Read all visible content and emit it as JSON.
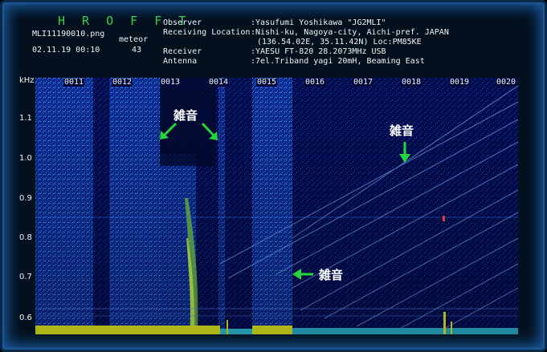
{
  "header": {
    "title": "H R O F F T",
    "filename": "MLI11190010.png",
    "mode": "meteor",
    "datetime": "02.11.19 00:10",
    "count": "43",
    "observer_label": "Observer",
    "observer_value": ":Yasufumi Yoshikawa \"JG2MLI\"",
    "location_label": "Receiving Location",
    "location_value": ":Nishi-ku, Nagoya-city, Aichi-pref. JAPAN",
    "location_value2": "(136.54.02E, 35.11.42N) Loc:PM85KE",
    "receiver_label": "Receiver",
    "receiver_value": ":YAESU FT-820 28.2073MHz USB",
    "antenna_label": "Antenna",
    "antenna_value": ":7el.Triband yagi 20mH, Beaming East"
  },
  "spectrogram": {
    "y_unit": "kHz",
    "y_ticks": [
      "1.1",
      "1.0",
      "0.9",
      "0.8",
      "0.7",
      "0.6"
    ],
    "x_ticks": [
      "0011",
      "0012",
      "0013",
      "0014",
      "0015",
      "0016",
      "0017",
      "0018",
      "0019",
      "0020"
    ],
    "colors": {
      "background": "#020a3a",
      "noise": "#1e6ad0",
      "signal": "#b8ff40",
      "baseline": "#e8f020"
    }
  },
  "annotations": {
    "noise_label_1": "雑音",
    "noise_label_2": "雑音",
    "noise_label_3": "雑音",
    "arrow_color": "#28d43c"
  }
}
